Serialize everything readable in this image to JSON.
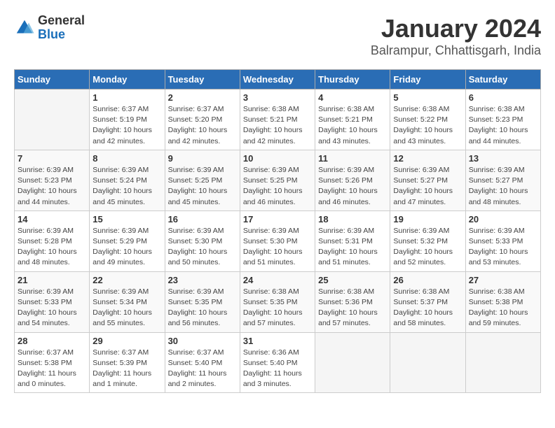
{
  "logo": {
    "general": "General",
    "blue": "Blue"
  },
  "title": "January 2024",
  "subtitle": "Balrampur, Chhattisgarh, India",
  "days_header": [
    "Sunday",
    "Monday",
    "Tuesday",
    "Wednesday",
    "Thursday",
    "Friday",
    "Saturday"
  ],
  "weeks": [
    [
      {
        "day": "",
        "info": ""
      },
      {
        "day": "1",
        "info": "Sunrise: 6:37 AM\nSunset: 5:19 PM\nDaylight: 10 hours\nand 42 minutes."
      },
      {
        "day": "2",
        "info": "Sunrise: 6:37 AM\nSunset: 5:20 PM\nDaylight: 10 hours\nand 42 minutes."
      },
      {
        "day": "3",
        "info": "Sunrise: 6:38 AM\nSunset: 5:21 PM\nDaylight: 10 hours\nand 42 minutes."
      },
      {
        "day": "4",
        "info": "Sunrise: 6:38 AM\nSunset: 5:21 PM\nDaylight: 10 hours\nand 43 minutes."
      },
      {
        "day": "5",
        "info": "Sunrise: 6:38 AM\nSunset: 5:22 PM\nDaylight: 10 hours\nand 43 minutes."
      },
      {
        "day": "6",
        "info": "Sunrise: 6:38 AM\nSunset: 5:23 PM\nDaylight: 10 hours\nand 44 minutes."
      }
    ],
    [
      {
        "day": "7",
        "info": "Sunrise: 6:39 AM\nSunset: 5:23 PM\nDaylight: 10 hours\nand 44 minutes."
      },
      {
        "day": "8",
        "info": "Sunrise: 6:39 AM\nSunset: 5:24 PM\nDaylight: 10 hours\nand 45 minutes."
      },
      {
        "day": "9",
        "info": "Sunrise: 6:39 AM\nSunset: 5:25 PM\nDaylight: 10 hours\nand 45 minutes."
      },
      {
        "day": "10",
        "info": "Sunrise: 6:39 AM\nSunset: 5:25 PM\nDaylight: 10 hours\nand 46 minutes."
      },
      {
        "day": "11",
        "info": "Sunrise: 6:39 AM\nSunset: 5:26 PM\nDaylight: 10 hours\nand 46 minutes."
      },
      {
        "day": "12",
        "info": "Sunrise: 6:39 AM\nSunset: 5:27 PM\nDaylight: 10 hours\nand 47 minutes."
      },
      {
        "day": "13",
        "info": "Sunrise: 6:39 AM\nSunset: 5:27 PM\nDaylight: 10 hours\nand 48 minutes."
      }
    ],
    [
      {
        "day": "14",
        "info": "Sunrise: 6:39 AM\nSunset: 5:28 PM\nDaylight: 10 hours\nand 48 minutes."
      },
      {
        "day": "15",
        "info": "Sunrise: 6:39 AM\nSunset: 5:29 PM\nDaylight: 10 hours\nand 49 minutes."
      },
      {
        "day": "16",
        "info": "Sunrise: 6:39 AM\nSunset: 5:30 PM\nDaylight: 10 hours\nand 50 minutes."
      },
      {
        "day": "17",
        "info": "Sunrise: 6:39 AM\nSunset: 5:30 PM\nDaylight: 10 hours\nand 51 minutes."
      },
      {
        "day": "18",
        "info": "Sunrise: 6:39 AM\nSunset: 5:31 PM\nDaylight: 10 hours\nand 51 minutes."
      },
      {
        "day": "19",
        "info": "Sunrise: 6:39 AM\nSunset: 5:32 PM\nDaylight: 10 hours\nand 52 minutes."
      },
      {
        "day": "20",
        "info": "Sunrise: 6:39 AM\nSunset: 5:33 PM\nDaylight: 10 hours\nand 53 minutes."
      }
    ],
    [
      {
        "day": "21",
        "info": "Sunrise: 6:39 AM\nSunset: 5:33 PM\nDaylight: 10 hours\nand 54 minutes."
      },
      {
        "day": "22",
        "info": "Sunrise: 6:39 AM\nSunset: 5:34 PM\nDaylight: 10 hours\nand 55 minutes."
      },
      {
        "day": "23",
        "info": "Sunrise: 6:39 AM\nSunset: 5:35 PM\nDaylight: 10 hours\nand 56 minutes."
      },
      {
        "day": "24",
        "info": "Sunrise: 6:38 AM\nSunset: 5:35 PM\nDaylight: 10 hours\nand 57 minutes."
      },
      {
        "day": "25",
        "info": "Sunrise: 6:38 AM\nSunset: 5:36 PM\nDaylight: 10 hours\nand 57 minutes."
      },
      {
        "day": "26",
        "info": "Sunrise: 6:38 AM\nSunset: 5:37 PM\nDaylight: 10 hours\nand 58 minutes."
      },
      {
        "day": "27",
        "info": "Sunrise: 6:38 AM\nSunset: 5:38 PM\nDaylight: 10 hours\nand 59 minutes."
      }
    ],
    [
      {
        "day": "28",
        "info": "Sunrise: 6:37 AM\nSunset: 5:38 PM\nDaylight: 11 hours\nand 0 minutes."
      },
      {
        "day": "29",
        "info": "Sunrise: 6:37 AM\nSunset: 5:39 PM\nDaylight: 11 hours\nand 1 minute."
      },
      {
        "day": "30",
        "info": "Sunrise: 6:37 AM\nSunset: 5:40 PM\nDaylight: 11 hours\nand 2 minutes."
      },
      {
        "day": "31",
        "info": "Sunrise: 6:36 AM\nSunset: 5:40 PM\nDaylight: 11 hours\nand 3 minutes."
      },
      {
        "day": "",
        "info": ""
      },
      {
        "day": "",
        "info": ""
      },
      {
        "day": "",
        "info": ""
      }
    ]
  ]
}
